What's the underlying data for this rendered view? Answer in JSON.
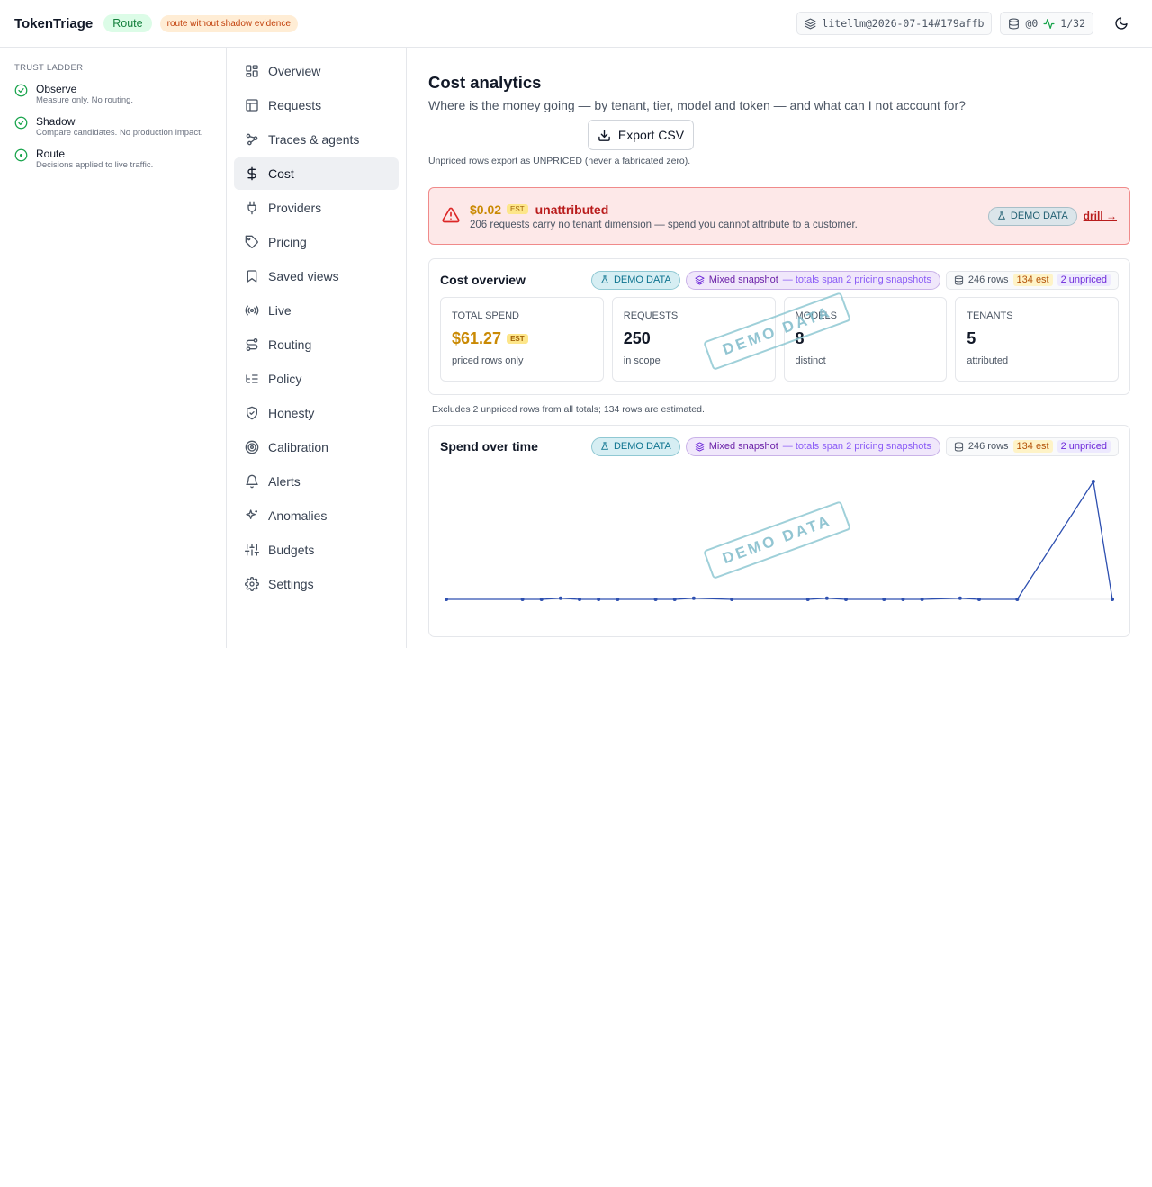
{
  "header": {
    "brand": "TokenTriage",
    "mode_badge": "Route",
    "warning_badge": "route without shadow evidence",
    "snapshot_chip": "litellm@2026-07-14#179affb",
    "db_chip": "@0",
    "health_chip": "1/32",
    "icons": [
      "layers-icon",
      "database-icon",
      "activity-icon",
      "moon-icon"
    ]
  },
  "ladder": {
    "title": "TRUST LADDER",
    "items": [
      {
        "name": "Observe",
        "desc": "Measure only. No routing.",
        "icon": "check-circle-icon"
      },
      {
        "name": "Shadow",
        "desc": "Compare candidates. No production impact.",
        "icon": "check-circle-icon"
      },
      {
        "name": "Route",
        "desc": "Decisions applied to live traffic.",
        "icon": "dot-circle-icon"
      }
    ]
  },
  "nav": {
    "items": [
      {
        "label": "Overview",
        "icon": "grid-icon"
      },
      {
        "label": "Requests",
        "icon": "table-icon"
      },
      {
        "label": "Traces & agents",
        "icon": "workflow-icon"
      },
      {
        "label": "Cost",
        "icon": "dollar-icon",
        "active": true
      },
      {
        "label": "Providers",
        "icon": "plug-icon"
      },
      {
        "label": "Pricing",
        "icon": "tag-icon"
      },
      {
        "label": "Saved views",
        "icon": "bookmark-icon"
      },
      {
        "label": "Live",
        "icon": "radio-icon"
      },
      {
        "label": "Routing",
        "icon": "route-icon"
      },
      {
        "label": "Policy",
        "icon": "list-tree-icon"
      },
      {
        "label": "Honesty",
        "icon": "shield-check-icon"
      },
      {
        "label": "Calibration",
        "icon": "target-icon"
      },
      {
        "label": "Alerts",
        "icon": "bell-icon"
      },
      {
        "label": "Anomalies",
        "icon": "sparkles-icon"
      },
      {
        "label": "Budgets",
        "icon": "sliders-icon"
      },
      {
        "label": "Settings",
        "icon": "gear-icon"
      }
    ]
  },
  "main": {
    "title": "Cost analytics",
    "subtitle": "Where is the money going — by tenant, tier, model and token — and what can I not account for?",
    "export_label": "Export CSV",
    "export_note": "Unpriced rows export as UNPRICED (never a fabricated zero).",
    "alert": {
      "amount": "$0.02",
      "est": "EST",
      "label": "unattributed",
      "desc": "206 requests carry no tenant dimension — spend you cannot attribute to a customer.",
      "demo": "DEMO DATA",
      "drill": "drill →"
    },
    "overview": {
      "title": "Cost overview",
      "demo": "DEMO DATA",
      "mixed_strong": "Mixed snapshot",
      "mixed_soft": "— totals span 2 pricing snapshots",
      "rows": "246 rows",
      "est": "134 est",
      "unpriced": "2 unpriced",
      "watermark": "DEMO DATA",
      "stats": [
        {
          "label": "TOTAL SPEND",
          "value": "$61.27",
          "badge": "EST",
          "sub": "priced rows only"
        },
        {
          "label": "REQUESTS",
          "value": "250",
          "sub": "in scope"
        },
        {
          "label": "MODELS",
          "value": "8",
          "sub": "distinct"
        },
        {
          "label": "TENANTS",
          "value": "5",
          "sub": "attributed"
        }
      ]
    },
    "excl_note": "Excludes 2 unpriced rows from all totals; 134 rows are estimated.",
    "spend": {
      "title": "Spend over time",
      "demo": "DEMO DATA",
      "mixed_strong": "Mixed snapshot",
      "mixed_soft": "— totals span 2 pricing snapshots",
      "rows": "246 rows",
      "est": "134 est",
      "unpriced": "2 unpriced",
      "watermark": "DEMO DATA"
    }
  },
  "chart_data": {
    "type": "line",
    "x": [
      0,
      4,
      5,
      6,
      7,
      8,
      9,
      11,
      12,
      13,
      15,
      19,
      20,
      21,
      23,
      24,
      25,
      27,
      28,
      30,
      34,
      35
    ],
    "values": [
      0,
      0,
      0,
      0.01,
      0,
      0,
      0,
      0,
      0,
      0.01,
      0,
      0,
      0.01,
      0,
      0,
      0,
      0,
      0.01,
      0,
      0,
      1.0,
      0
    ],
    "color": "#2d4fb0",
    "grid": false
  },
  "colors": {
    "accent_green": "#15803d",
    "warning_orange": "#c2410c",
    "alert_red": "#b91c1c",
    "money_gold": "#ca8a04",
    "demo_teal": "#0e7490",
    "mixed_purple": "#6d28d9"
  }
}
